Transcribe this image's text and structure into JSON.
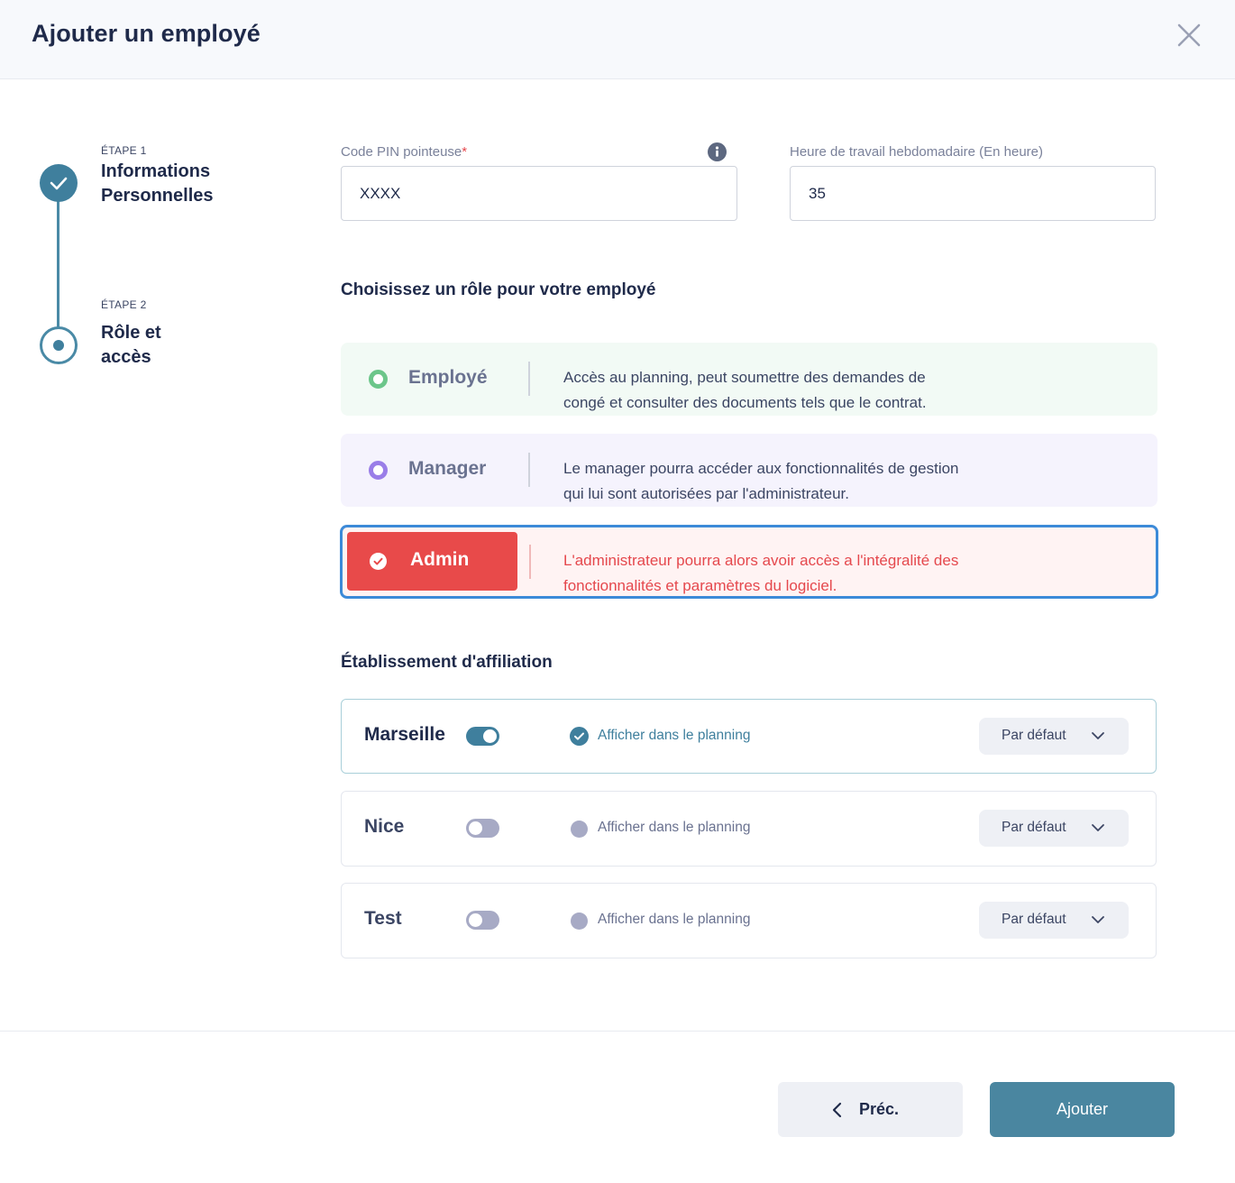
{
  "header": {
    "title": "Ajouter un employé"
  },
  "stepper": {
    "steps": [
      {
        "tag": "ÉTAPE 1",
        "title_line1": "Informations",
        "title_line2": "Personnelles",
        "state": "done"
      },
      {
        "tag": "ÉTAPE 2",
        "title_line1": "Rôle et",
        "title_line2": "accès",
        "state": "current"
      }
    ]
  },
  "fields": {
    "pin": {
      "label": "Code PIN pointeuse",
      "required_mark": "*",
      "value": "XXXX"
    },
    "hours": {
      "label": "Heure de travail hebdomadaire (En heure)",
      "value": "35"
    }
  },
  "roles": {
    "section_title": "Choisissez un rôle pour votre employé",
    "items": [
      {
        "name": "Employé",
        "desc_line1": "Accès au planning, peut soumettre des demandes de",
        "desc_line2": "congé et consulter des documents tels que le contrat.",
        "color": "#6cc68a"
      },
      {
        "name": "Manager",
        "desc_line1": "Le manager pourra accéder aux fonctionnalités de gestion",
        "desc_line2": "qui lui sont autorisées par l'administrateur.",
        "color": "#9a7ee8"
      },
      {
        "name": "Admin",
        "desc_line1": "L'administrateur pourra alors avoir accès a l'intégralité des",
        "desc_line2": "fonctionnalités et paramètres du logiciel.",
        "color": "#e84a4a",
        "selected": true
      }
    ]
  },
  "establishments": {
    "section_title": "Établissement d'affiliation",
    "items": [
      {
        "name": "Marseille",
        "enabled": true,
        "show_label": "Afficher dans le planning",
        "show_checked": true,
        "select_value": "Par défaut"
      },
      {
        "name": "Nice",
        "enabled": false,
        "show_label": "Afficher dans le planning",
        "show_checked": false,
        "select_value": "Par défaut"
      },
      {
        "name": "Test",
        "enabled": false,
        "show_label": "Afficher dans le planning",
        "show_checked": false,
        "select_value": "Par défaut"
      }
    ]
  },
  "footer": {
    "prev_label": "Préc.",
    "submit_label": "Ajouter"
  },
  "colors": {
    "primary": "#3f7f9d",
    "danger": "#e84a4a",
    "focus": "#3c8ad8"
  }
}
